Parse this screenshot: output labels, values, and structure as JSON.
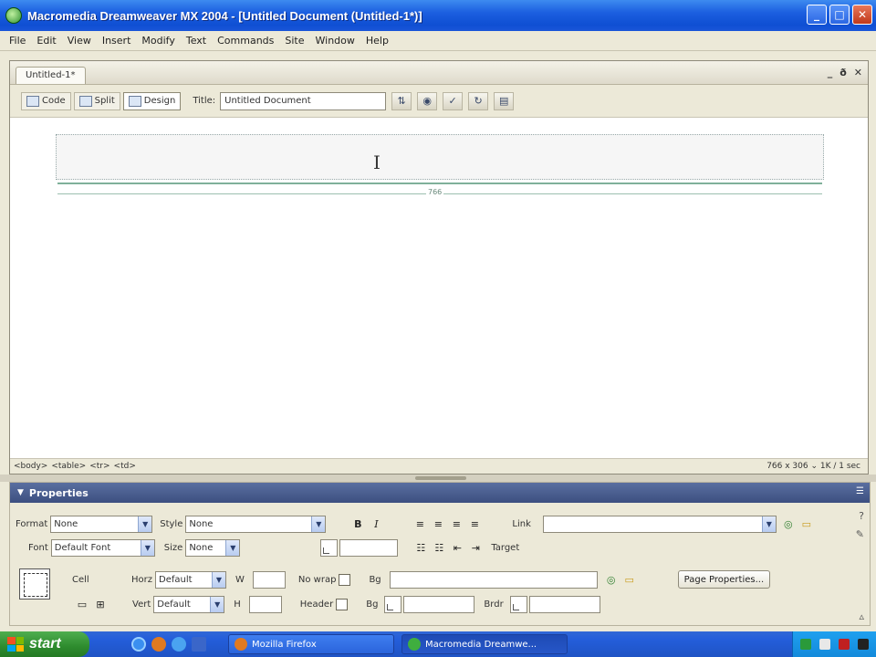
{
  "window": {
    "title": "Macromedia Dreamweaver MX 2004 - [Untitled Document (Untitled-1*)]",
    "controls": {
      "minimize": "_",
      "maximize": "□",
      "close": "✕"
    }
  },
  "menu": [
    "File",
    "Edit",
    "View",
    "Insert",
    "Modify",
    "Text",
    "Commands",
    "Site",
    "Window",
    "Help"
  ],
  "document": {
    "tab": "Untitled-1*",
    "tab_controls": [
      "_",
      "ð",
      "✕"
    ],
    "views": {
      "code": "Code",
      "split": "Split",
      "design": "Design"
    },
    "title_label": "Title:",
    "title_value": "Untitled Document",
    "table_width_label": "766",
    "status": {
      "tags": [
        "<body>",
        "<table>",
        "<tr>",
        "<td>"
      ],
      "info": "766 x 306 ⌄ 1K / 1 sec"
    }
  },
  "properties": {
    "header": "Properties",
    "format_label": "Format",
    "format_value": "None",
    "style_label": "Style",
    "style_value": "None",
    "bold": "B",
    "italic": "I",
    "link_label": "Link",
    "font_label": "Font",
    "font_value": "Default Font",
    "size_label": "Size",
    "size_value": "None",
    "target_label": "Target",
    "cell_label": "Cell",
    "horz_label": "Horz",
    "horz_value": "Default",
    "w_label": "W",
    "nowrap_label": "No wrap",
    "bg_label": "Bg",
    "page_properties": "Page Properties...",
    "vert_label": "Vert",
    "vert_value": "Default",
    "h_label": "H",
    "header_label": "Header",
    "bg2_label": "Bg",
    "brdr_label": "Brdr"
  },
  "taskbar": {
    "start": "start",
    "tasks": [
      "Mozilla Firefox",
      "Macromedia Dreamwe..."
    ]
  }
}
